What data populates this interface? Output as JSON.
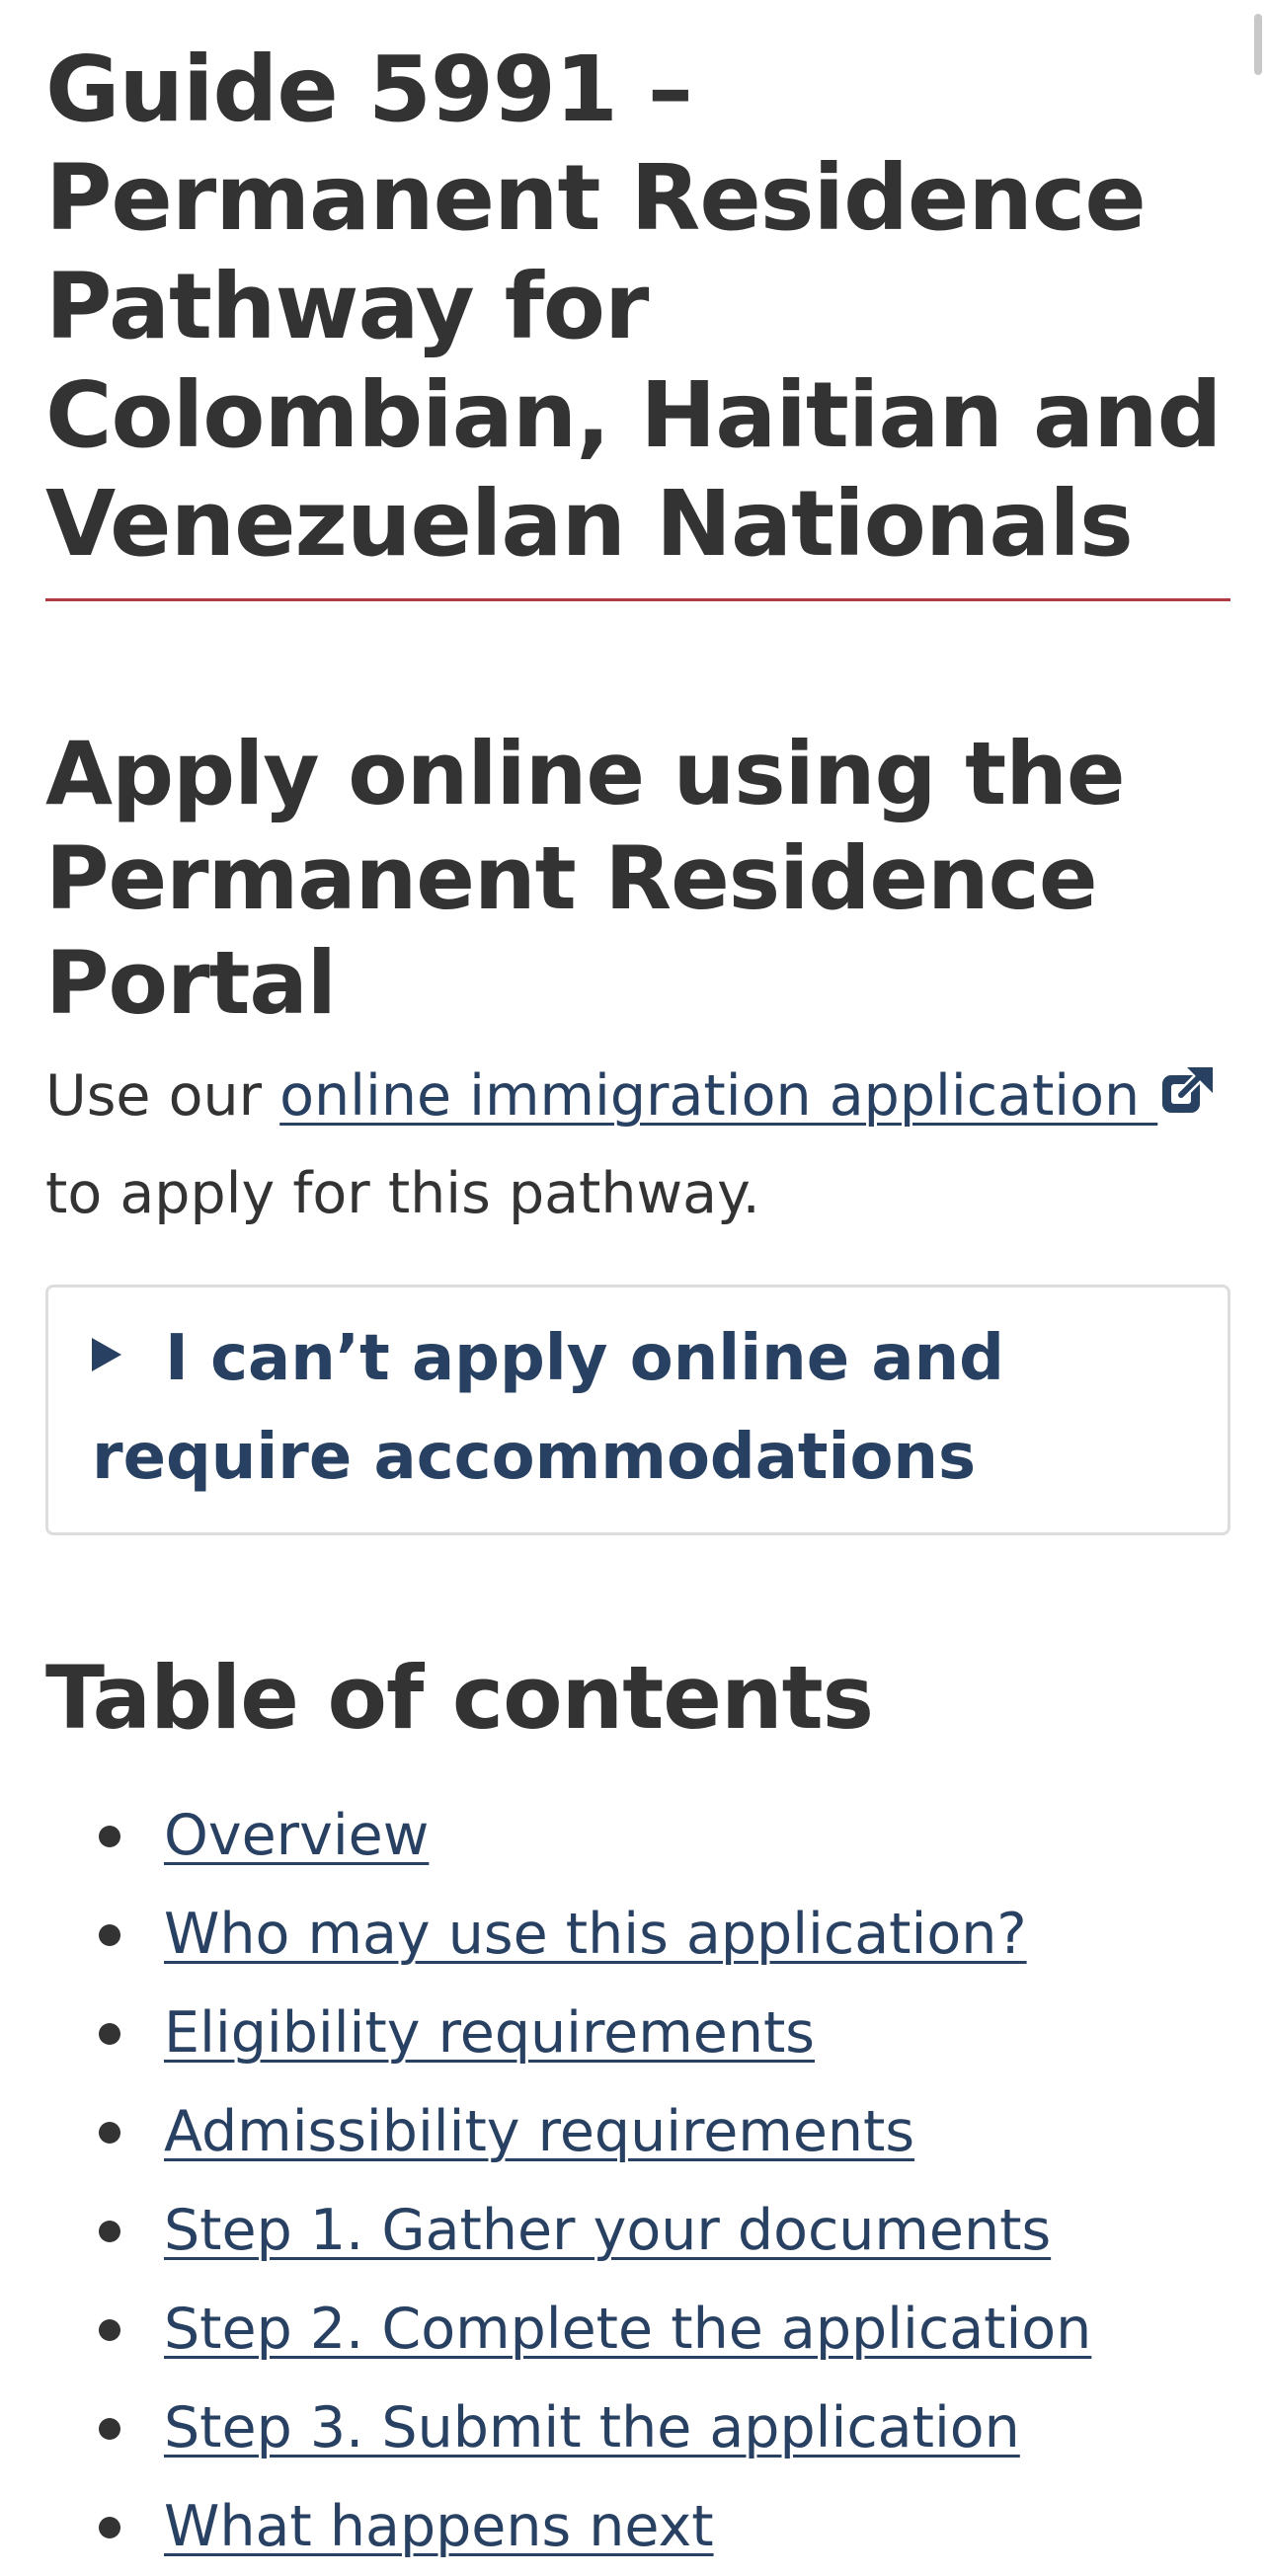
{
  "page": {
    "title": "Guide 5991 – Permanent Residence Pathway for Colombian, Haitian and Venezuelan Nationals"
  },
  "apply_section": {
    "heading": "Apply online using the Permanent Residence Portal",
    "text_before": "Use our ",
    "link_label": "online immigration application ",
    "text_after": " to apply for this pathway.",
    "link_icon": "external-link-icon"
  },
  "details": {
    "summary_label": "I can’t apply online and require accommodations",
    "icon": "triangle-right-icon"
  },
  "toc": {
    "heading": "Table of contents",
    "items": [
      "Overview",
      "Who may use this application?",
      "Eligibility requirements",
      "Admissibility requirements",
      "Step 1. Gather your documents",
      "Step 2. Complete the application",
      "Step 3. Submit the application",
      "What happens next"
    ]
  },
  "colors": {
    "text": "#333333",
    "link": "#284162",
    "title_rule": "#af3c43",
    "details_border": "#dddddd"
  }
}
